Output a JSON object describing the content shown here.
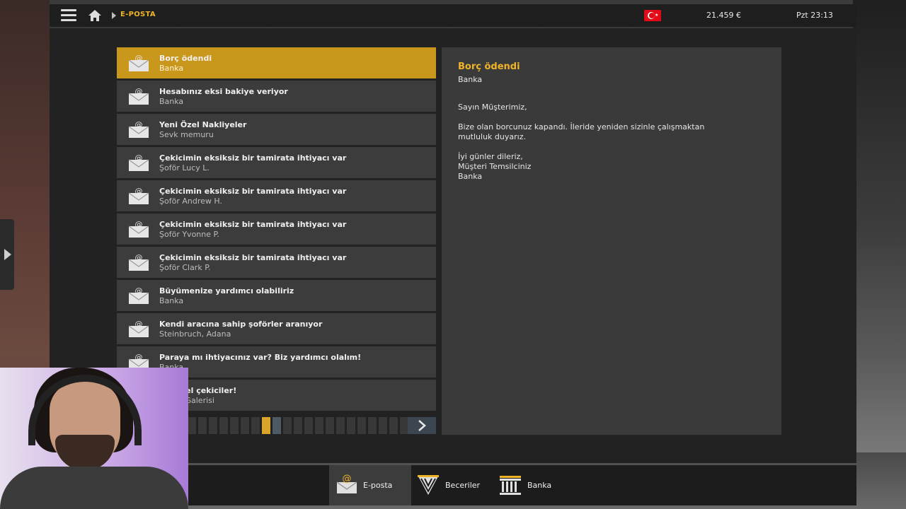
{
  "topbar": {
    "breadcrumb": "E-POSTA",
    "money": "21.459 €",
    "clock": "Pzt 23:13"
  },
  "mails": [
    {
      "subject": "Borç ödendi",
      "sender": "Banka",
      "selected": true
    },
    {
      "subject": "Hesabınız eksi bakiye veriyor",
      "sender": "Banka"
    },
    {
      "subject": "Yeni Özel Nakliyeler",
      "sender": "Sevk memuru"
    },
    {
      "subject": "Çekicimin eksiksiz bir tamirata ihtiyacı var",
      "sender": "Şoför Lucy L."
    },
    {
      "subject": "Çekicimin eksiksiz bir tamirata ihtiyacı var",
      "sender": "Şoför Andrew H."
    },
    {
      "subject": "Çekicimin eksiksiz bir tamirata ihtiyacı var",
      "sender": "Şoför Yvonne P."
    },
    {
      "subject": "Çekicimin eksiksiz bir tamirata ihtiyacı var",
      "sender": "Şoför Clark P."
    },
    {
      "subject": "Büyümenize yardımcı olabiliriz",
      "sender": "Banka"
    },
    {
      "subject": "Kendi aracına sahip şoförler aranıyor",
      "sender": "Steinbruch, Adana"
    },
    {
      "subject": "Paraya mı ihtiyacınız var? Biz yardımcı olalım!",
      "sender": "Banka"
    },
    {
      "subject": "İkinci el çekiciler!",
      "sender": "Çekici Galerisi"
    }
  ],
  "reader": {
    "subject": "Borç ödendi",
    "sender": "Banka",
    "greeting": "Sayın Müşterimiz,",
    "body": "Bize olan borcunuz kapandı. İleride yeniden sizinle çalışmaktan mutluluk duyarız.",
    "closing1": "İyi günler dileriz,",
    "closing2": "Müşteri Temsilciniz",
    "closing3": "Banka"
  },
  "pager": {
    "current_page": 8,
    "total_pages": 21
  },
  "nav": {
    "email": "E-posta",
    "skills": "Beceriler",
    "bank": "Banka"
  },
  "colors": {
    "accent": "#f0b429",
    "selected_row": "#c9971c",
    "row": "#3c3c3c",
    "panel": "#222222"
  }
}
